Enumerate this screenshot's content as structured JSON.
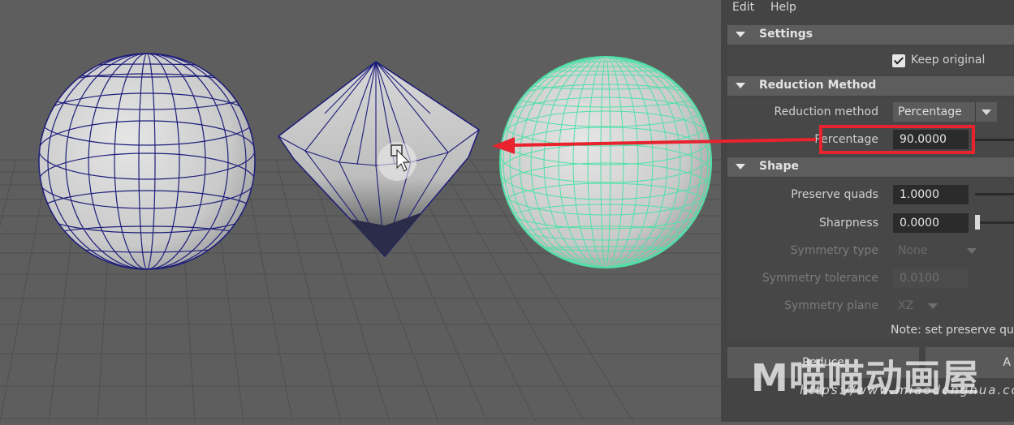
{
  "menu": {
    "edit": "Edit",
    "help": "Help"
  },
  "settings": {
    "title": "Settings",
    "keep_original_label": "Keep original",
    "keep_original_checked": true
  },
  "reduction": {
    "title": "Reduction Method",
    "method_label": "Reduction method",
    "method_value": "Percentage",
    "percentage_label": "Percentage",
    "percentage_value": "90.0000"
  },
  "shape": {
    "title": "Shape",
    "preserve_quads_label": "Preserve quads",
    "preserve_quads_value": "1.0000",
    "sharpness_label": "Sharpness",
    "sharpness_value": "0.0000",
    "symmetry_type_label": "Symmetry type",
    "symmetry_type_value": "None",
    "symmetry_tolerance_label": "Symmetry tolerance",
    "symmetry_tolerance_value": "0.0100",
    "symmetry_plane_label": "Symmetry plane",
    "symmetry_plane_value": "XZ",
    "note": "Note: set preserve quads"
  },
  "buttons": {
    "reduce": "Reduce",
    "apply_partial": "A"
  },
  "watermark": {
    "text": "M喵喵动画屋",
    "url": "https://www.miaodonghua.com"
  },
  "colors": {
    "highlight": "#e8232e",
    "selected_mesh": "#4fe0a8",
    "wire": "#1d1d7a"
  }
}
